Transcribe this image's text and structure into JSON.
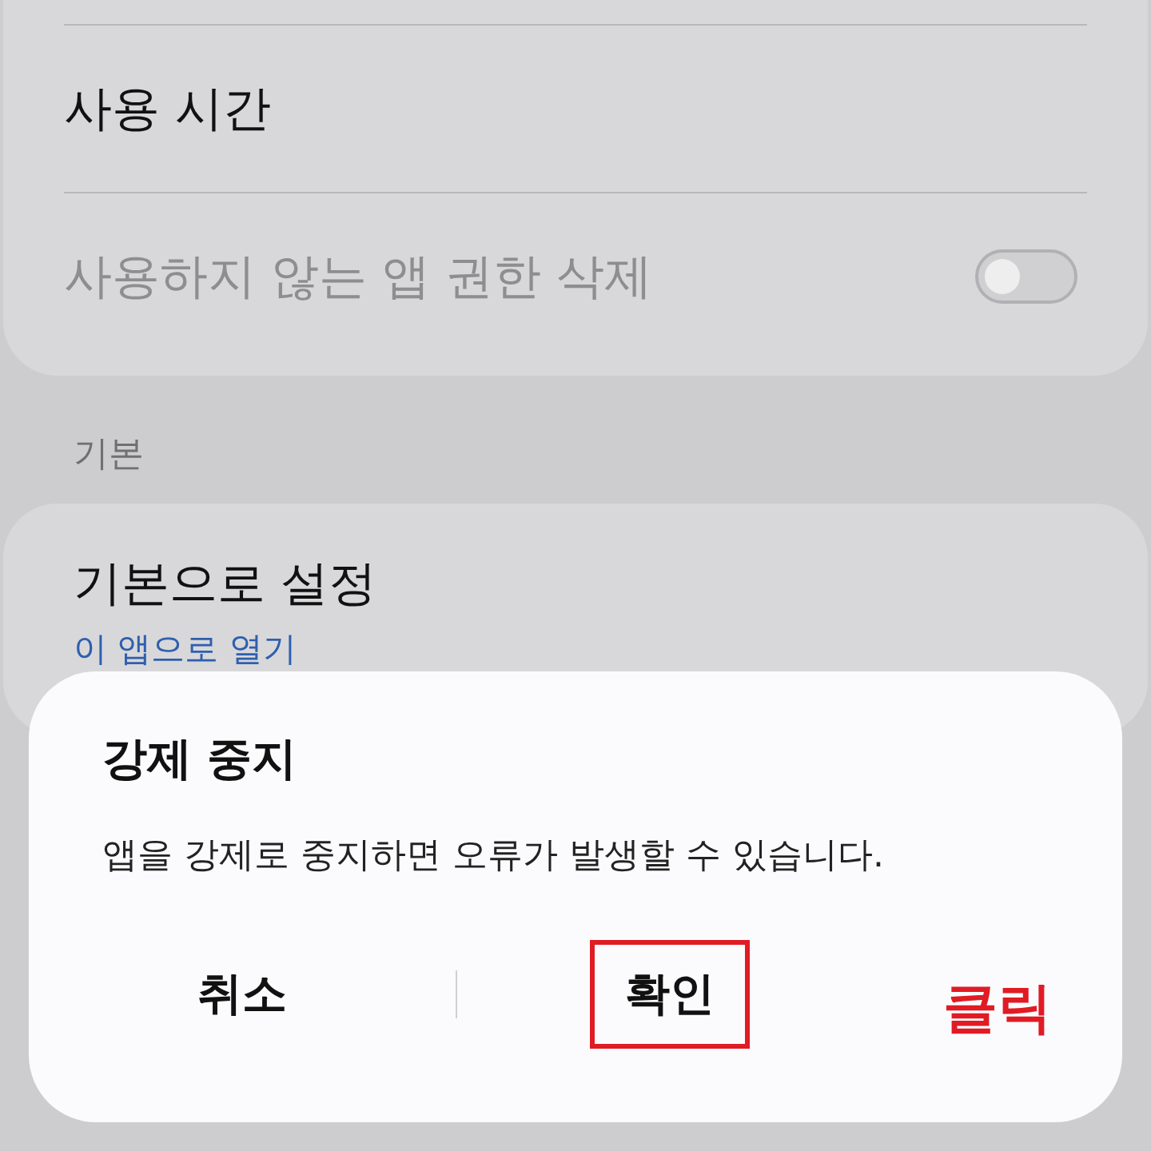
{
  "usage_card": {
    "rows": [
      {
        "label": "사용 시간",
        "kind": "plain",
        "disabled": false
      },
      {
        "label": "사용하지 않는 앱 권한 삭제",
        "kind": "toggle",
        "disabled": true,
        "on": false
      }
    ]
  },
  "section": {
    "header": "기본",
    "title": "기본으로 설정",
    "link": "이 앱으로 열기"
  },
  "dialog": {
    "title": "강제 중지",
    "message": "앱을 강제로 중지하면 오류가 발생할 수 있습니다.",
    "buttons": [
      {
        "label": "취소",
        "highlighted": false
      },
      {
        "label": "확인",
        "highlighted": true
      }
    ],
    "annotation": "클릭"
  }
}
